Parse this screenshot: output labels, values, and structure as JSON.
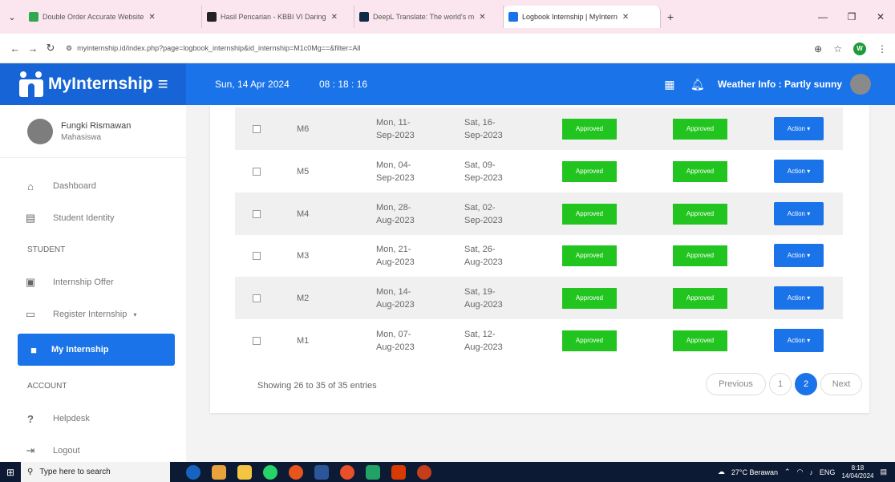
{
  "browser": {
    "tabs": [
      {
        "title": "Double Order Accurate Website",
        "color": "#2fa84f",
        "active": false
      },
      {
        "title": "Hasil Pencarian - KBBI VI Daring",
        "color": "#222222",
        "active": false
      },
      {
        "title": "DeepL Translate: The world's m",
        "color": "#0f2b46",
        "active": false
      },
      {
        "title": "Logbook Internship | MyIntern",
        "color": "#1a73e8",
        "active": true
      }
    ],
    "new_tab": "+",
    "url": "myinternship.id/index.php?page=logbook_internship&id_internship=M1c0Mg==&filter=All",
    "profile_letter": "W"
  },
  "header": {
    "brand": "MyInternship",
    "date": "Sun, 14 Apr 2024",
    "time": "08 : 18 : 16",
    "weather": "Weather Info : Partly sunny"
  },
  "sidebar": {
    "user_name": "Fungki Rismawan",
    "user_role": "Mahasiswa",
    "items": [
      {
        "label": "Dashboard",
        "icon": "home-icon"
      },
      {
        "label": "Student Identity",
        "icon": "id-card-icon"
      }
    ],
    "section_student": "STUDENT",
    "student_items": [
      {
        "label": "Internship Offer",
        "icon": "clipboard-icon"
      },
      {
        "label": "Register Internship",
        "icon": "form-icon"
      },
      {
        "label": "My Internship",
        "icon": "briefcase-icon"
      }
    ],
    "section_account": "ACCOUNT",
    "account_items": [
      {
        "label": "Helpdesk",
        "icon": "question-icon"
      },
      {
        "label": "Logout",
        "icon": "logout-icon"
      }
    ]
  },
  "table": {
    "rows": [
      {
        "code": "M6",
        "start_a": "Mon, 11-",
        "start_b": "Sep-2023",
        "end_a": "Sat, 16-",
        "end_b": "Sep-2023",
        "status1": "Approved",
        "status2": "Approved",
        "action": "Action ▾"
      },
      {
        "code": "M5",
        "start_a": "Mon, 04-",
        "start_b": "Sep-2023",
        "end_a": "Sat, 09-",
        "end_b": "Sep-2023",
        "status1": "Approved",
        "status2": "Approved",
        "action": "Action ▾"
      },
      {
        "code": "M4",
        "start_a": "Mon, 28-",
        "start_b": "Aug-2023",
        "end_a": "Sat, 02-",
        "end_b": "Sep-2023",
        "status1": "Approved",
        "status2": "Approved",
        "action": "Action ▾"
      },
      {
        "code": "M3",
        "start_a": "Mon, 21-",
        "start_b": "Aug-2023",
        "end_a": "Sat, 26-",
        "end_b": "Aug-2023",
        "status1": "Approved",
        "status2": "Approved",
        "action": "Action ▾"
      },
      {
        "code": "M2",
        "start_a": "Mon, 14-",
        "start_b": "Aug-2023",
        "end_a": "Sat, 19-",
        "end_b": "Aug-2023",
        "status1": "Approved",
        "status2": "Approved",
        "action": "Action ▾"
      },
      {
        "code": "M1",
        "start_a": "Mon, 07-",
        "start_b": "Aug-2023",
        "end_a": "Sat, 12-",
        "end_b": "Aug-2023",
        "status1": "Approved",
        "status2": "Approved",
        "action": "Action ▾"
      }
    ],
    "showing": "Showing 26 to 35 of 35 entries",
    "pager": {
      "previous": "Previous",
      "page1": "1",
      "page2": "2",
      "next": "Next"
    }
  },
  "taskbar": {
    "search_placeholder": "Type here to search",
    "weather": "27°C Berawan",
    "lang": "ENG",
    "clock_time": "8:18",
    "clock_date": "14/04/2024"
  }
}
